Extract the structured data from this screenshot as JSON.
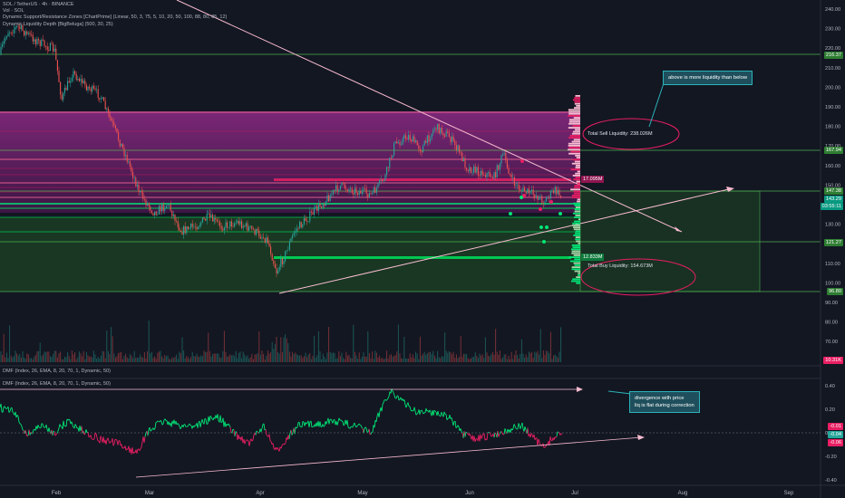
{
  "header": {
    "symbol_line": "SOL / TetherUS · 4h · BINANCE",
    "vol_line": "Vol · SOL",
    "indicator1": "Dynamic Support/Resistance Zones [ChartPrime] (Linear, 50, 3, 75, 5, 10, 20, 50, 100, 88, 80, 85, 12)",
    "indicator2": "Dynamic Liquidity Depth [BigBeluga] (500, 30, 25)"
  },
  "price_axis": [
    "240.00",
    "230.00",
    "220.00",
    "210.00",
    "200.00",
    "190.00",
    "180.00",
    "170.00",
    "160.00",
    "150.00",
    "140.00",
    "130.00",
    "120.00",
    "110.00",
    "100.00",
    "90.00",
    "80.00",
    "70.00"
  ],
  "price_tags": {
    "t1": "216.37",
    "t2": "167.94",
    "t3": "147.38",
    "t4": "143.29",
    "t5": "03:55:11",
    "t6": "121.27",
    "t7": "96.80",
    "t8": "10.31K"
  },
  "dmf_axis": [
    "0.40",
    "0.20",
    "0.00",
    "-0.20",
    "-0.40"
  ],
  "dmf_tags": {
    "a": "-0.01",
    "b": "-0.04",
    "c": "-0.06"
  },
  "dmf_legend1": "DMF (Index, 26, EMA, 8, 20, 70, 1, Dynamic, 50)",
  "dmf_legend2": "DMF (Index, 26, EMA, 8, 20, 70, 1, Dynamic, 50)",
  "time_axis": [
    "Feb",
    "Mar",
    "Apr",
    "May",
    "Jun",
    "Jul",
    "Aug",
    "Sep"
  ],
  "liquidity": {
    "sell": "Total Sell Liquidity: 238.026M",
    "buy": "Total Buy Liquidity: 154.673M",
    "tag_sell": "17.095M",
    "tag_buy": "12.833M"
  },
  "callouts": {
    "top": "above is more liquidity than below",
    "dmf_line1": "divergence with price",
    "dmf_line2": "liq is flat during correction"
  },
  "colors": {
    "bg": "#131722",
    "sell_zone": "#7b1f6e",
    "buy_zone": "#1e4d2b",
    "up": "#26a69a",
    "down": "#ef5350",
    "level_green": "#4caf50",
    "trend_pink": "#f8bbd0"
  }
}
